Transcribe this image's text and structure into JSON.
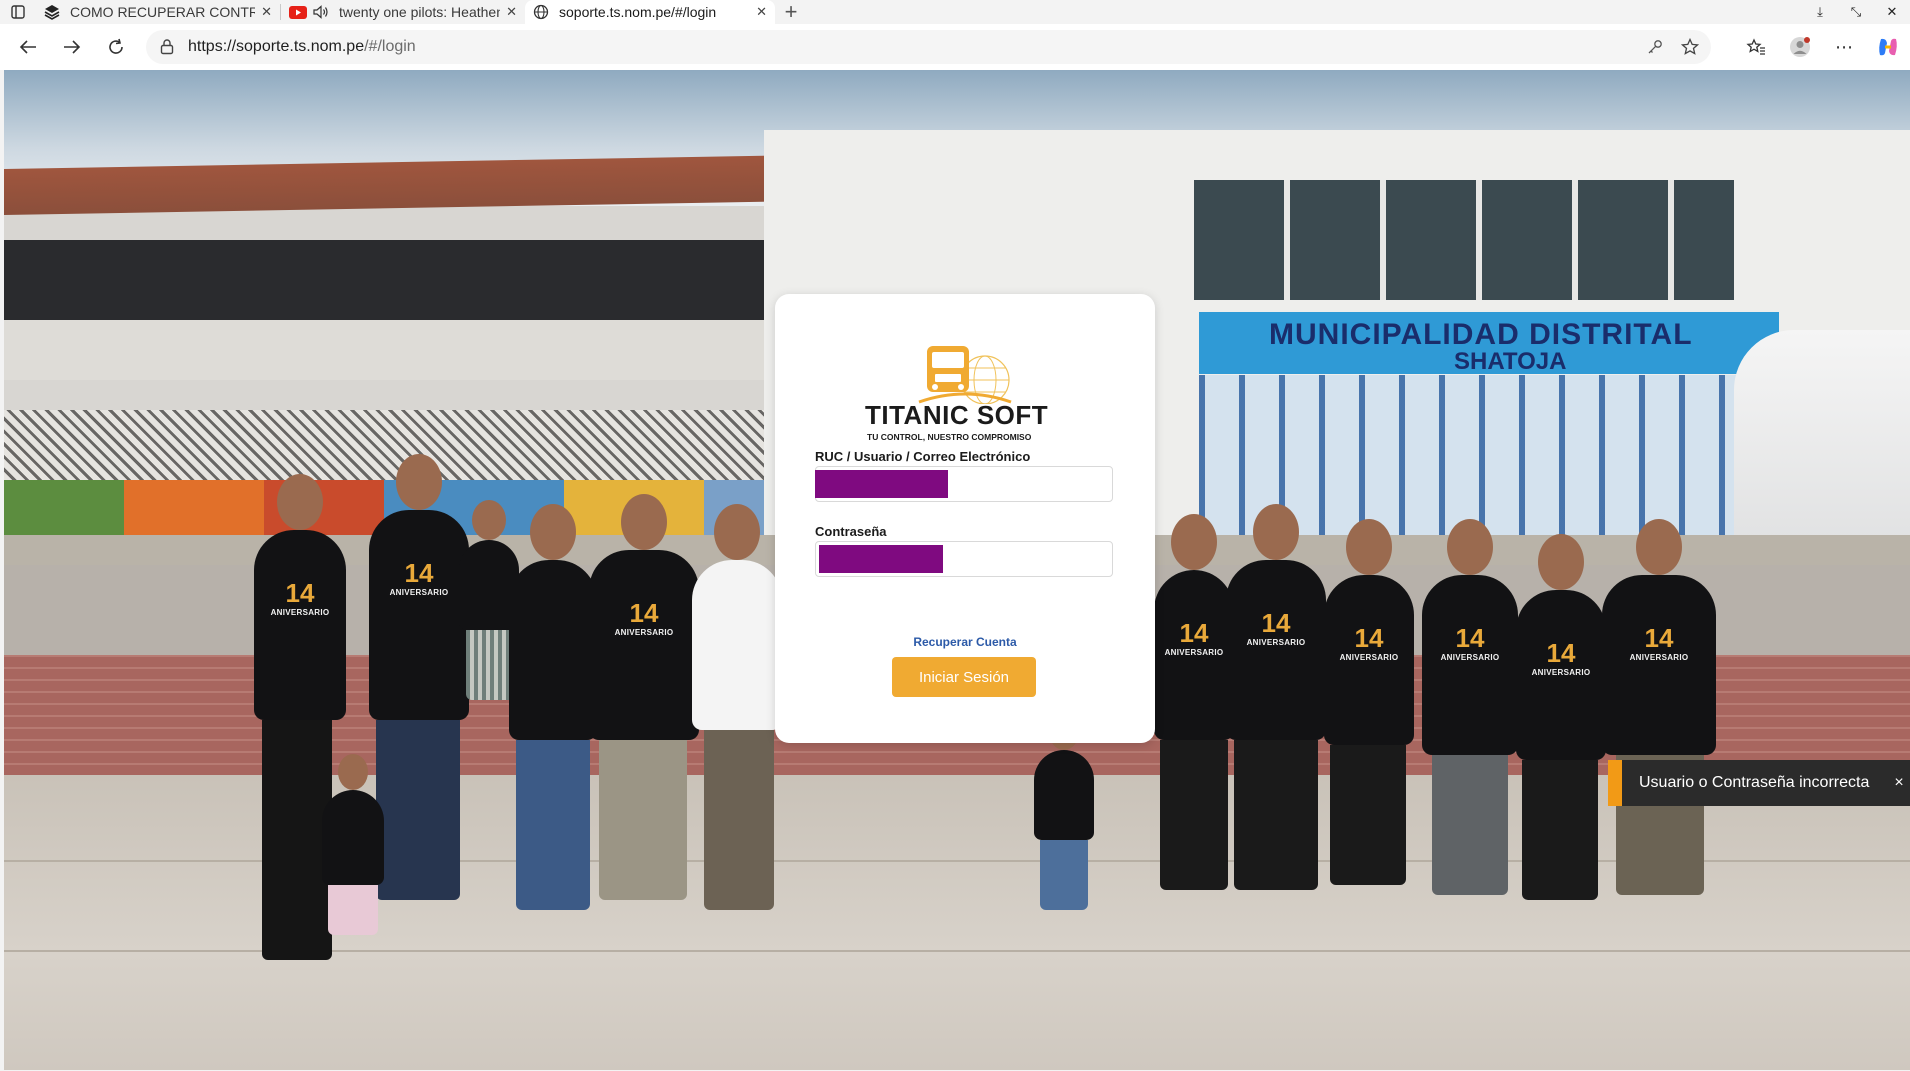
{
  "browser": {
    "tabs": [
      {
        "label": "COMO RECUPERAR CONTRASEÑA",
        "icon": "layers-icon",
        "active": false
      },
      {
        "label": "twenty one pilots: Heathens",
        "icon": "youtube-icon",
        "active": false
      },
      {
        "label": "soporte.ts.nom.pe/#/login",
        "icon": "globe-icon",
        "active": true
      }
    ],
    "new_tab_label": "+",
    "url_host": "https://soporte.ts.nom.pe",
    "url_path": "/#/login"
  },
  "brand": {
    "name": "TITANIC SOFT",
    "tagline": "TU CONTROL, NUESTRO COMPROMISO",
    "accent": "#f0aa32"
  },
  "login": {
    "user_label": "RUC / Usuario / Correo Electrónico",
    "password_label": "Contraseña",
    "recover_link": "Recuperar Cuenta",
    "submit_label": "Iniciar Sesión",
    "redaction_color": "#7f0a80"
  },
  "toast": {
    "message": "Usuario o Contraseña incorrecta",
    "close": "×",
    "accent": "#f29a16"
  },
  "background": {
    "sign_line1": "MUNICIPALIDAD DISTRITAL",
    "sign_line2": "SHATOJA",
    "shirt_number": "14",
    "shirt_text": "ANIVERSARIO"
  }
}
